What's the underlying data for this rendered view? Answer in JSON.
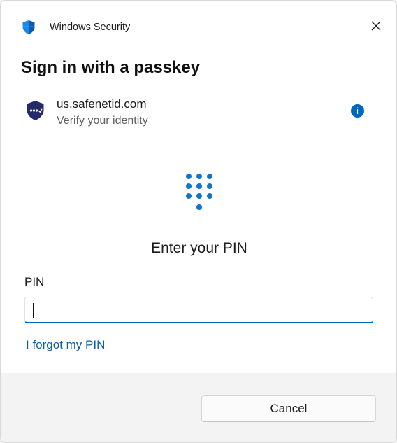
{
  "window": {
    "app_title": "Windows Security",
    "app_icon": "shield-icon",
    "close_icon": "close-icon"
  },
  "dialog": {
    "heading": "Sign in with a passkey",
    "site": {
      "domain": "us.safenetid.com",
      "subtitle": "Verify your identity",
      "logo_icon": "safenet-shield-icon",
      "info_icon": "info-icon",
      "info_glyph": "i"
    },
    "keypad_icon": "pin-keypad-icon",
    "prompt": "Enter your PIN",
    "pin_field": {
      "label": "PIN",
      "value": ""
    },
    "forgot_link": "I forgot my PIN"
  },
  "footer": {
    "cancel_label": "Cancel"
  },
  "colors": {
    "accent": "#0067c0",
    "link": "#0a5ea8",
    "footer_bg": "#f3f3f3"
  }
}
